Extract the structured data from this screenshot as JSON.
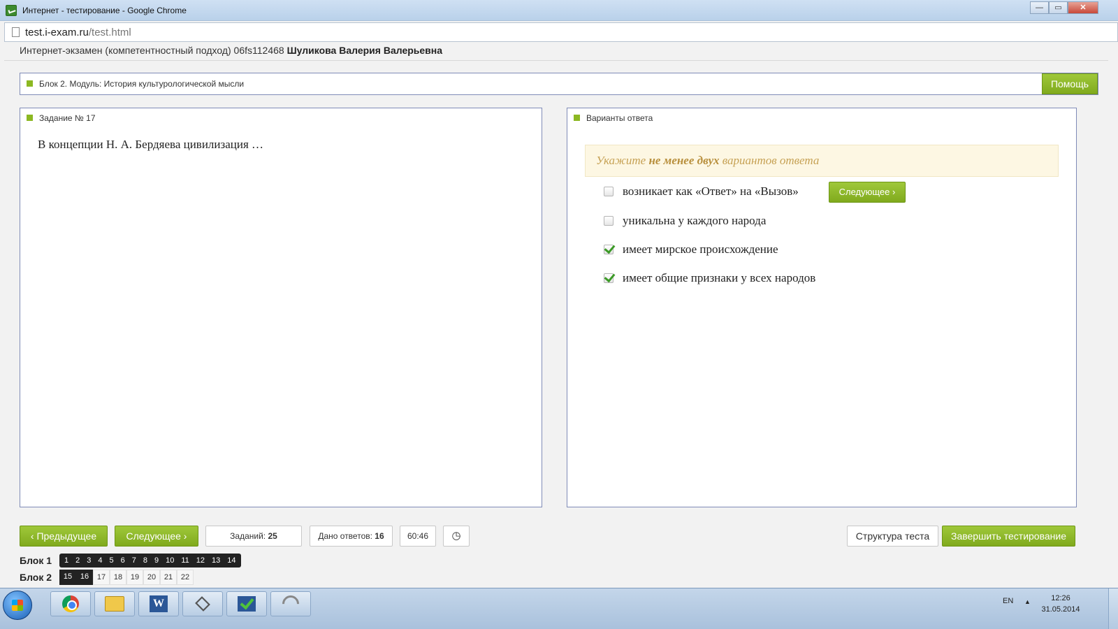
{
  "window": {
    "title": "Интернет - тестирование - Google Chrome",
    "controls": {
      "minimize": "—",
      "maximize": "▭",
      "close": "✕"
    }
  },
  "address": {
    "host": "test.i-exam.ru",
    "path": "/test.html"
  },
  "header": {
    "prefix": "Интернет-экзамен (компетентностный подход) 06fs112468",
    "student": "Шуликова Валерия Валерьевна"
  },
  "block_bar": {
    "label": "Блок 2. Модуль: История культурологической мысли",
    "help": "Помощь"
  },
  "task": {
    "title": "Задание № 17",
    "question": "В концепции Н. А. Бердяева цивилизация …"
  },
  "answers": {
    "title": "Варианты ответа",
    "hint_pre": "Укажите ",
    "hint_bold": "не менее двух",
    "hint_post": " вариантов ответа",
    "next_inline": "Следующее",
    "options": [
      {
        "text": "возникает как «Ответ» на «Вызов»",
        "checked": false
      },
      {
        "text": "уникальна у каждого народа",
        "checked": false
      },
      {
        "text": "имеет мирское происхождение",
        "checked": true
      },
      {
        "text": "имеет общие признаки у всех народов",
        "checked": true
      }
    ]
  },
  "footer": {
    "prev": "Предыдущее",
    "next": "Следующее",
    "tasks_label": "Заданий:",
    "tasks_value": "25",
    "answered_label": "Дано ответов:",
    "answered_value": "16",
    "timer": "60:46",
    "structure": "Структура теста",
    "finish": "Завершить тестирование"
  },
  "blocks": {
    "block1_label": "Блок 1",
    "block1_numbers": [
      "1",
      "2",
      "3",
      "4",
      "5",
      "6",
      "7",
      "8",
      "9",
      "10",
      "11",
      "12",
      "13",
      "14"
    ],
    "block2_label": "Блок 2",
    "block2_answered": [
      "15",
      "16"
    ],
    "block2_pending": [
      "17",
      "18",
      "19",
      "20",
      "21",
      "22"
    ]
  },
  "taskbar": {
    "lang": "EN",
    "time": "12:26",
    "date": "31.05.2014",
    "apps": [
      "chrome-icon",
      "folder-icon",
      "word-icon",
      "app-icon",
      "checkmark-icon",
      "network-icon"
    ]
  },
  "colors": {
    "accent_green": "#8cb822",
    "panel_border": "#7f8bb7",
    "hint_bg": "#fdf7e3",
    "hint_text": "#c6a154"
  }
}
